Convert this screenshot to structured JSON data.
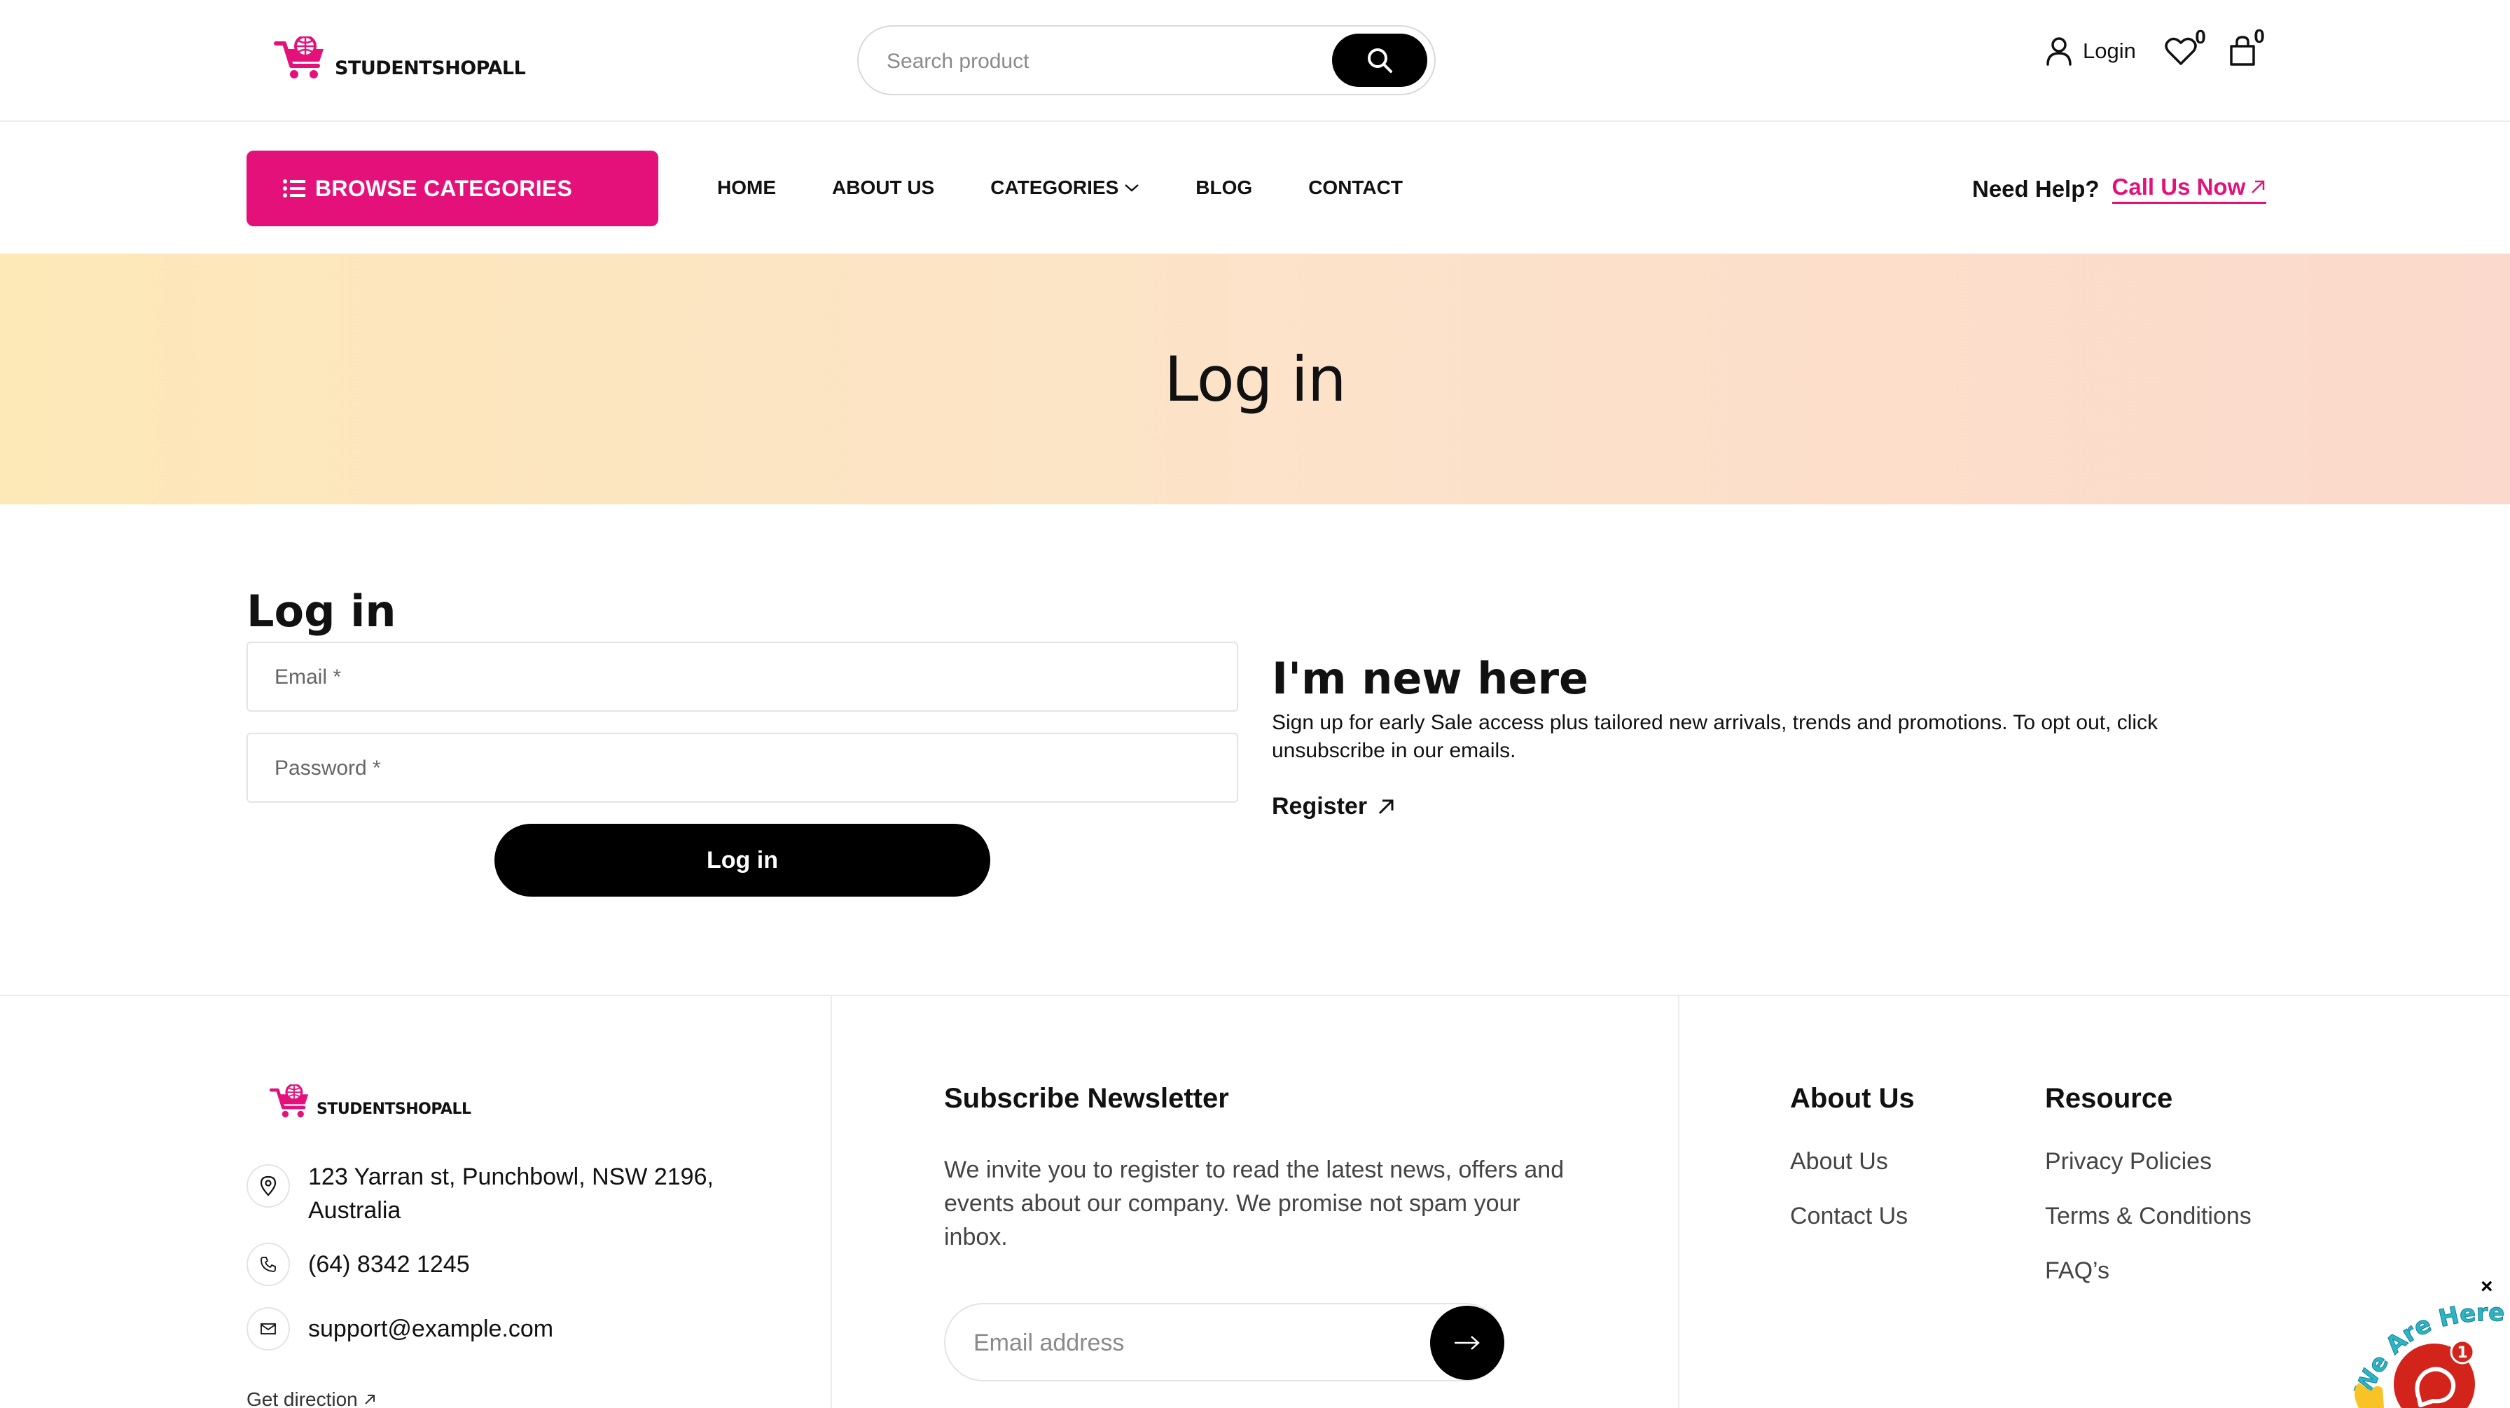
{
  "header": {
    "logo_text": "STUDENTSHOPALL",
    "search_placeholder": "Search product",
    "login_label": "Login",
    "wishlist_count": "0",
    "cart_count": "0"
  },
  "nav": {
    "browse_label": "BROWSE CATEGORIES",
    "items": [
      "HOME",
      "ABOUT US",
      "CATEGORIES",
      "BLOG",
      "CONTACT"
    ],
    "help_label": "Need Help?",
    "help_link": "Call Us Now"
  },
  "banner": {
    "title": "Log in"
  },
  "login": {
    "title": "Log in",
    "email_placeholder": "Email *",
    "password_placeholder": "Password *",
    "submit_label": "Log in"
  },
  "register": {
    "title": "I'm new here",
    "description": "Sign up for early Sale access plus tailored new arrivals, trends and promotions. To opt out, click unsubscribe in our emails.",
    "link_label": "Register"
  },
  "footer": {
    "logo_text": "STUDENTSHOPALL",
    "address": "123 Yarran st, Punchbowl, NSW 2196, Australia",
    "phone": "(64) 8342 1245",
    "email": "support@example.com",
    "get_direction": "Get direction",
    "newsletter": {
      "title": "Subscribe Newsletter",
      "description": "We invite you to register to read the latest news, offers and events about our company. We promise not spam your inbox.",
      "email_placeholder": "Email address"
    },
    "about": {
      "title": "About Us",
      "links": [
        "About Us",
        "Contact Us"
      ]
    },
    "resource": {
      "title": "Resource",
      "links": [
        "Privacy Policies",
        "Terms & Conditions",
        "FAQ’s"
      ]
    }
  },
  "chat": {
    "banner_text": "We Are Here!",
    "badge_count": "1",
    "close_label": "×"
  },
  "colors": {
    "brand_pink": "#e4117b",
    "black": "#000000",
    "banner_start": "#fde8b8",
    "banner_end": "#fbd9cc",
    "chat_red": "#d3241c",
    "chat_teal": "#2bb5c8"
  },
  "icons": {
    "logo": "shopping-cart-globe-icon",
    "search": "search-icon",
    "user": "user-icon",
    "wishlist": "heart-icon",
    "cart": "shopping-bag-icon",
    "browse": "list-icon",
    "categories_dropdown": "chevron-down-icon",
    "external": "arrow-up-right-icon",
    "address": "map-pin-icon",
    "phone": "phone-icon",
    "email": "mail-icon",
    "newsletter_submit": "arrow-right-icon",
    "chat": "chat-bubble-icon"
  }
}
